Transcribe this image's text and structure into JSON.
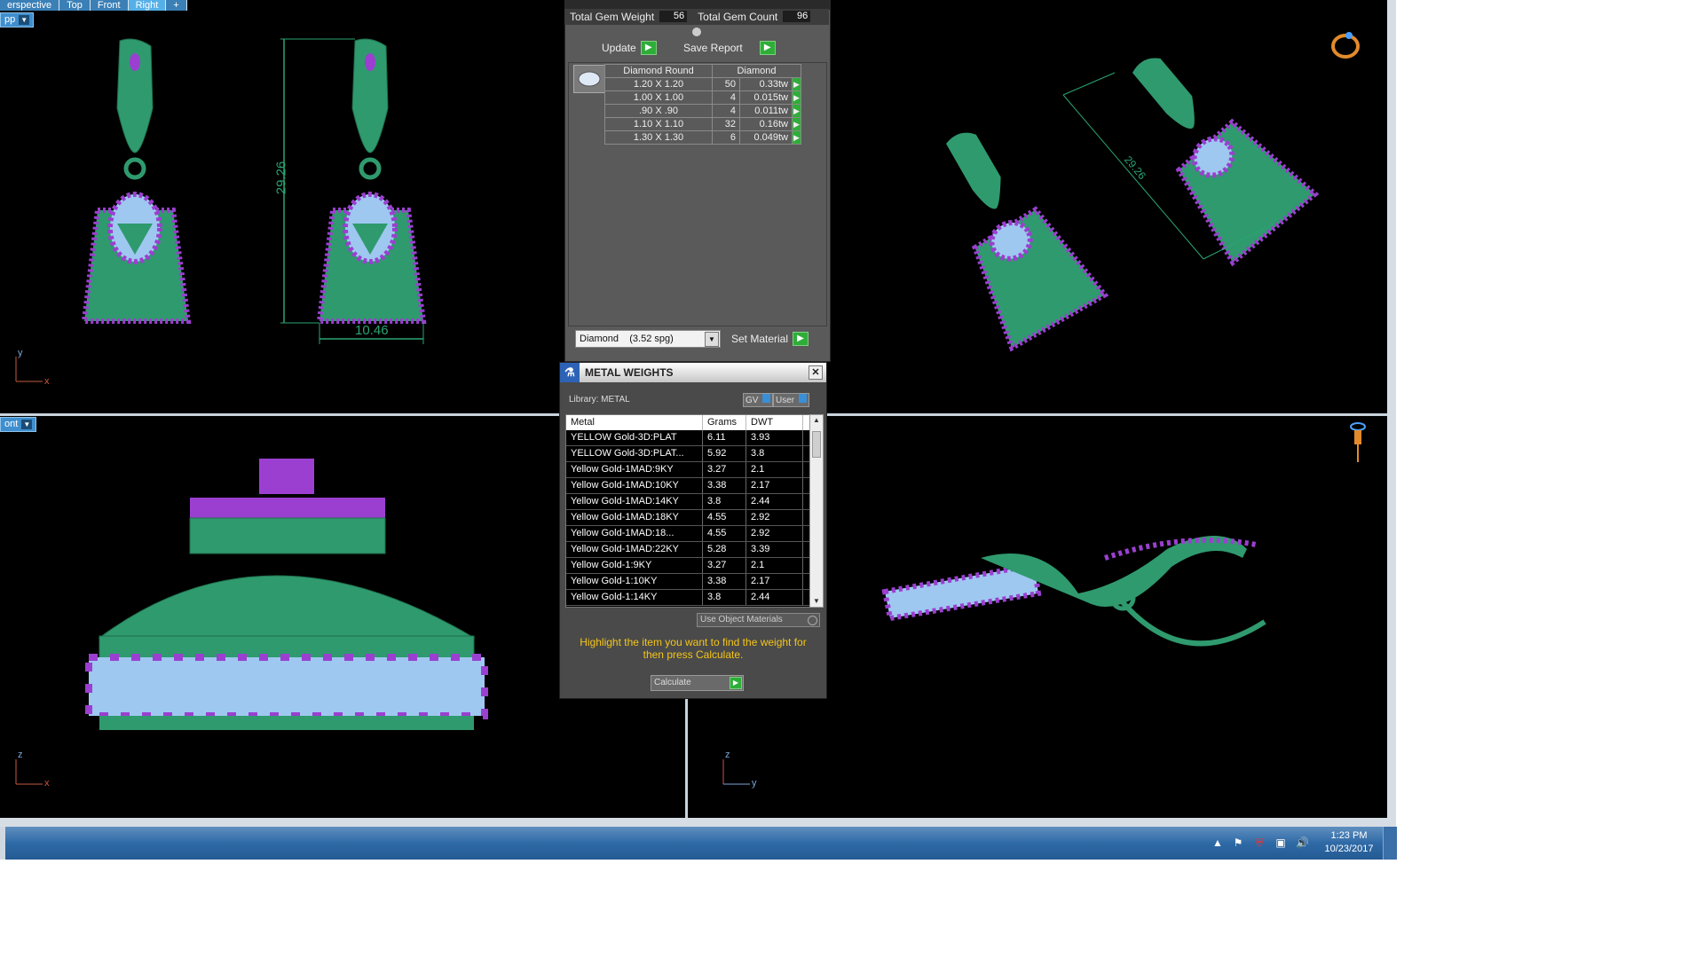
{
  "viewports": {
    "tabs": [
      "erspective",
      "Top",
      "Front",
      "Right",
      "+"
    ],
    "active_tab": "Right",
    "top_left_dropdown": "pp",
    "bottom_left_dropdown": "ont",
    "dimensions": {
      "height": "29.26",
      "width": "10.46",
      "diag": "29.26"
    },
    "axes": {
      "tl": [
        "y",
        "x"
      ],
      "bl": [
        "z",
        "x"
      ],
      "br": [
        "z",
        "y"
      ]
    }
  },
  "gem_report": {
    "total_weight_label": "Total Gem Weight",
    "total_weight_value": "56",
    "total_count_label": "Total Gem Count",
    "total_count_value": "96",
    "update_label": "Update",
    "save_report_label": "Save Report",
    "table_headers": [
      "Diamond Round",
      "Diamond"
    ],
    "rows": [
      {
        "size": "1.20 X 1.20",
        "count": "50",
        "weight": "0.33tw"
      },
      {
        "size": "1.00 X 1.00",
        "count": "4",
        "weight": "0.015tw"
      },
      {
        "size": ".90 X .90",
        "count": "4",
        "weight": "0.011tw"
      },
      {
        "size": "1.10 X 1.10",
        "count": "32",
        "weight": "0.16tw"
      },
      {
        "size": "1.30 X 1.30",
        "count": "6",
        "weight": "0.049tw"
      }
    ],
    "material_select": "Diamond    (3.52 spg)",
    "set_material_label": "Set Material"
  },
  "metal_weights": {
    "title": "METAL WEIGHTS",
    "library_label": "Library: METAL",
    "gv_label": "GV",
    "user_label": "User",
    "columns": [
      "Metal",
      "Grams",
      "DWT"
    ],
    "rows": [
      {
        "metal": "YELLOW Gold-3D:PLAT",
        "grams": "6.11",
        "dwt": "3.93"
      },
      {
        "metal": "YELLOW Gold-3D:PLAT...",
        "grams": "5.92",
        "dwt": "3.8"
      },
      {
        "metal": "Yellow Gold-1MAD:9KY",
        "grams": "3.27",
        "dwt": "2.1"
      },
      {
        "metal": "Yellow Gold-1MAD:10KY",
        "grams": "3.38",
        "dwt": "2.17"
      },
      {
        "metal": "Yellow Gold-1MAD:14KY",
        "grams": "3.8",
        "dwt": "2.44"
      },
      {
        "metal": "Yellow Gold-1MAD:18KY",
        "grams": "4.55",
        "dwt": "2.92"
      },
      {
        "metal": "Yellow Gold-1MAD:18...",
        "grams": "4.55",
        "dwt": "2.92"
      },
      {
        "metal": "Yellow Gold-1MAD:22KY",
        "grams": "5.28",
        "dwt": "3.39"
      },
      {
        "metal": "Yellow Gold-1:9KY",
        "grams": "3.27",
        "dwt": "2.1"
      },
      {
        "metal": "Yellow Gold-1:10KY",
        "grams": "3.38",
        "dwt": "2.17"
      },
      {
        "metal": "Yellow Gold-1:14KY",
        "grams": "3.8",
        "dwt": "2.44"
      }
    ],
    "use_object_materials_label": "Use Object Materials",
    "instruction": "Highlight the item you want to find the weight for then press Calculate.",
    "calculate_label": "Calculate"
  },
  "taskbar": {
    "time": "1:23 PM",
    "date": "10/23/2017"
  },
  "colors": {
    "metal_green": "#2f9a6e",
    "gem_purple": "#9b3fd0",
    "gem_blue": "#9ec8f0",
    "dimension_green": "#2aa572",
    "instruction_yellow": "#f5c518"
  }
}
